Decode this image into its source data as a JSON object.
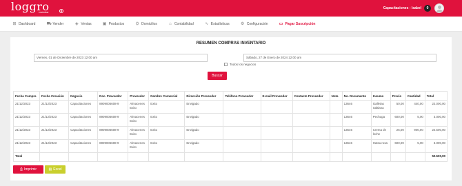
{
  "header": {
    "logo": "loggro",
    "logo_sub": "restobar",
    "user_label": "Capacitaciones - Isabel",
    "notif_count": "0"
  },
  "nav": [
    {
      "label": "Dashboard",
      "icon": "dashboard-icon",
      "glyph": "⊞"
    },
    {
      "label": "Vender",
      "icon": "cart-icon",
      "glyph": "⛟"
    },
    {
      "label": "Ventas",
      "icon": "tag-icon",
      "glyph": "◈"
    },
    {
      "label": "Productos",
      "icon": "box-icon",
      "glyph": "▣"
    },
    {
      "label": "Domicilios",
      "icon": "motorbike-icon",
      "glyph": "⛭"
    },
    {
      "label": "Contabilidad",
      "icon": "bank-icon",
      "glyph": "⌂"
    },
    {
      "label": "Estadísticas",
      "icon": "chart-line-icon",
      "glyph": "∿"
    },
    {
      "label": "Configuración",
      "icon": "gear-icon",
      "glyph": "⚙"
    },
    {
      "label": "Pagar Suscripción",
      "icon": "card-icon",
      "glyph": "▭"
    }
  ],
  "title": "RESUMEN COMPRAS INVENTARIO",
  "filter": {
    "date_from": "Viernes, 01 de Diciembre de 2023 12:00 am",
    "date_to": "Sábado, 27 de Enero de 2024 12:00 am",
    "all_business_label": "Todos los negocios",
    "search_label": "Buscar"
  },
  "table": {
    "headers": [
      "Fecha Compra",
      "Fecha Creación",
      "Negocio",
      "Doc. Proveedor",
      "Proveedor",
      "Nombre Comercial",
      "Dirección Proveedor",
      "Teléfono Proveedor",
      "E-mail Proveedor",
      "Contacto Proveedor",
      "Nota",
      "No. Documento",
      "Insumo",
      "Precio",
      "Cantidad",
      "Total"
    ],
    "rows": [
      [
        "21/12/2023",
        "21/12/2023",
        "Capacitaciones",
        "8909006608-9",
        "Almacenes Exito",
        "Exito",
        "Envigado",
        "",
        "",
        "",
        "",
        "13646",
        "Galletas Saltiana",
        "50,00",
        "440,00",
        "22.000,00"
      ],
      [
        "21/12/2023",
        "21/12/2023",
        "Capacitaciones",
        "8909006608-9",
        "Almacenes Exito",
        "Exito",
        "Envigado",
        "",
        "",
        "",
        "",
        "13646",
        "Pechuga",
        "600,00",
        "5,00",
        "3.000,00"
      ],
      [
        "21/12/2023",
        "21/12/2023",
        "Capacitaciones",
        "8909006608-9",
        "Almacenes Exito",
        "Exito",
        "Envigado",
        "",
        "",
        "",
        "",
        "13646",
        "Crema de leche",
        "25,00",
        "900,00",
        "22.500,00"
      ],
      [
        "21/12/2023",
        "21/12/2023",
        "Capacitaciones",
        "8909006608-9",
        "Almacenes Exito",
        "Exito",
        "Envigado",
        "",
        "",
        "",
        "",
        "13646",
        "Hatsu rosa",
        "600,00",
        "5,00",
        "3.000,00"
      ]
    ],
    "total_label": "Total",
    "total_value": "50.500,00"
  },
  "actions": {
    "print_label": "Imprimir",
    "excel_label": "Excel"
  },
  "colors": {
    "brand": "#e0123d",
    "excel": "#c9cf2d"
  }
}
